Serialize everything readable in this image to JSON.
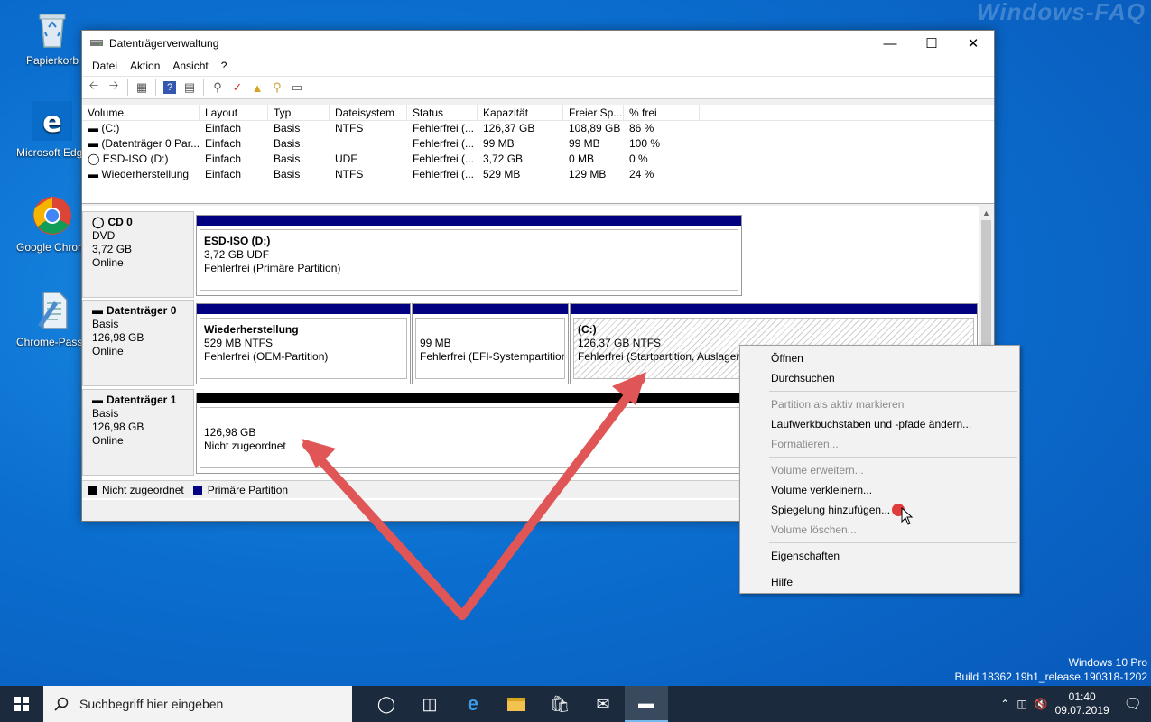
{
  "watermark": "Windows-FAQ",
  "desktop": {
    "icons": [
      {
        "label": "Papierkorb"
      },
      {
        "label": "Microsoft Edge"
      },
      {
        "label": "Google Chrome"
      },
      {
        "label": "Chrome-Passwort"
      }
    ]
  },
  "window": {
    "title": "Datenträgerverwaltung",
    "menu": [
      "Datei",
      "Aktion",
      "Ansicht",
      "?"
    ],
    "columns": [
      "Volume",
      "Layout",
      "Typ",
      "Dateisystem",
      "Status",
      "Kapazität",
      "Freier Sp...",
      "% frei"
    ],
    "rows": [
      [
        "(C:)",
        "Einfach",
        "Basis",
        "NTFS",
        "Fehlerfrei (...",
        "126,37 GB",
        "108,89 GB",
        "86 %"
      ],
      [
        "(Datenträger 0 Par...",
        "Einfach",
        "Basis",
        "",
        "Fehlerfrei (...",
        "99 MB",
        "99 MB",
        "100 %"
      ],
      [
        "ESD-ISO (D:)",
        "Einfach",
        "Basis",
        "UDF",
        "Fehlerfrei (...",
        "3,72 GB",
        "0 MB",
        "0 %"
      ],
      [
        "Wiederherstellung",
        "Einfach",
        "Basis",
        "NTFS",
        "Fehlerfrei (...",
        "529 MB",
        "129 MB",
        "24 %"
      ]
    ],
    "disks": {
      "cd0": {
        "name": "CD 0",
        "type": "DVD",
        "size": "3,72 GB",
        "state": "Online",
        "part": {
          "title": "ESD-ISO  (D:)",
          "line2": "3,72 GB UDF",
          "line3": "Fehlerfrei (Primäre Partition)"
        }
      },
      "disk0": {
        "name": "Datenträger 0",
        "type": "Basis",
        "size": "126,98 GB",
        "state": "Online",
        "p1": {
          "title": "Wiederherstellung",
          "line2": "529 MB NTFS",
          "line3": "Fehlerfrei (OEM-Partition)"
        },
        "p2": {
          "line2": "99 MB",
          "line3": "Fehlerfrei (EFI-Systempartition)"
        },
        "p3": {
          "title": "(C:)",
          "line2": "126,37 GB NTFS",
          "line3": "Fehlerfrei (Startpartition, Auslagerungsdatei"
        }
      },
      "disk1": {
        "name": "Datenträger 1",
        "type": "Basis",
        "size": "126,98 GB",
        "state": "Online",
        "p1": {
          "line2": "126,98 GB",
          "line3": "Nicht zugeordnet"
        }
      }
    },
    "legend": [
      "Nicht zugeordnet",
      "Primäre Partition"
    ],
    "colors": {
      "primary": "#000080",
      "unallocated": "#000000"
    }
  },
  "context_menu": {
    "items": [
      "Öffnen",
      "Durchsuchen",
      "Partition als aktiv markieren",
      "Laufwerkbuchstaben und -pfade ändern...",
      "Formatieren...",
      "Volume erweitern...",
      "Volume verkleinern...",
      "Spiegelung hinzufügen...",
      "Volume löschen...",
      "Eigenschaften",
      "Hilfe"
    ]
  },
  "taskbar": {
    "search_placeholder": "Suchbegriff hier eingeben",
    "time": "01:40",
    "date": "09.07.2019"
  },
  "os_version": {
    "line1": "Windows 10 Pro",
    "line2": "Build 18362.19h1_release.190318-1202"
  }
}
